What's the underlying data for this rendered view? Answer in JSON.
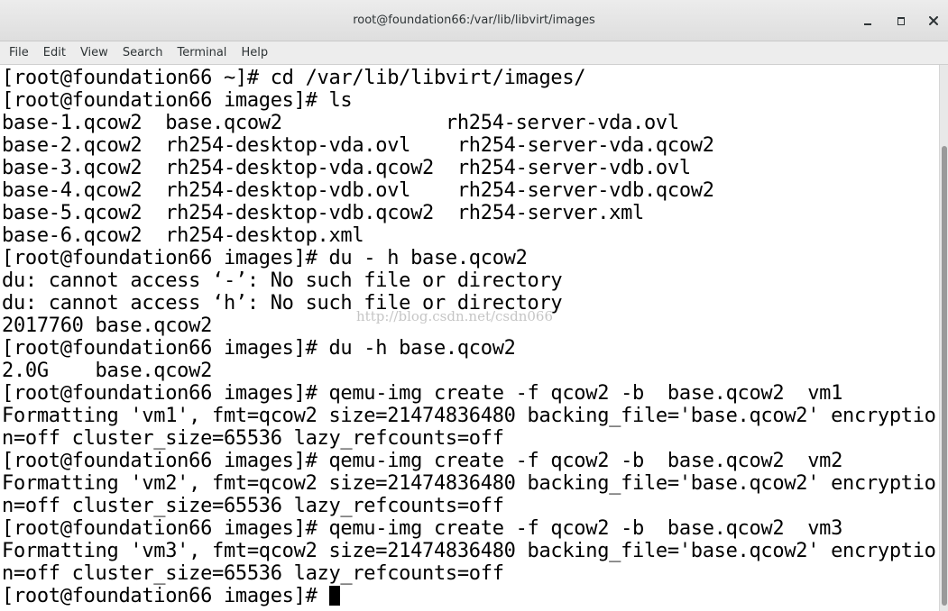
{
  "window": {
    "title": "root@foundation66:/var/lib/libvirt/images"
  },
  "menu": {
    "items": [
      "File",
      "Edit",
      "View",
      "Search",
      "Terminal",
      "Help"
    ]
  },
  "terminal": {
    "lines": [
      "[root@foundation66 ~]# cd /var/lib/libvirt/images/",
      "[root@foundation66 images]# ls",
      "base-1.qcow2  base.qcow2              rh254-server-vda.ovl",
      "base-2.qcow2  rh254-desktop-vda.ovl    rh254-server-vda.qcow2",
      "base-3.qcow2  rh254-desktop-vda.qcow2  rh254-server-vdb.ovl",
      "base-4.qcow2  rh254-desktop-vdb.ovl    rh254-server-vdb.qcow2",
      "base-5.qcow2  rh254-desktop-vdb.qcow2  rh254-server.xml",
      "base-6.qcow2  rh254-desktop.xml",
      "[root@foundation66 images]# du - h base.qcow2",
      "du: cannot access ‘-’: No such file or directory",
      "du: cannot access ‘h’: No such file or directory",
      "2017760 base.qcow2",
      "[root@foundation66 images]# du -h base.qcow2",
      "2.0G    base.qcow2",
      "[root@foundation66 images]# qemu-img create -f qcow2 -b  base.qcow2  vm1",
      "Formatting 'vm1', fmt=qcow2 size=21474836480 backing_file='base.qcow2' encryptio",
      "n=off cluster_size=65536 lazy_refcounts=off",
      "[root@foundation66 images]# qemu-img create -f qcow2 -b  base.qcow2  vm2",
      "Formatting 'vm2', fmt=qcow2 size=21474836480 backing_file='base.qcow2' encryptio",
      "n=off cluster_size=65536 lazy_refcounts=off",
      "[root@foundation66 images]# qemu-img create -f qcow2 -b  base.qcow2  vm3",
      "Formatting 'vm3', fmt=qcow2 size=21474836480 backing_file='base.qcow2' encryptio",
      "n=off cluster_size=65536 lazy_refcounts=off"
    ],
    "prompt": "[root@foundation66 images]# "
  },
  "watermark": "http://blog.csdn.net/csdn066",
  "colors": {
    "background": "#ffffff",
    "text": "#000000",
    "titlebar": "#e4e4e4"
  },
  "icons": {
    "minimize": "minimize-icon",
    "maximize": "maximize-icon",
    "close": "close-icon"
  }
}
